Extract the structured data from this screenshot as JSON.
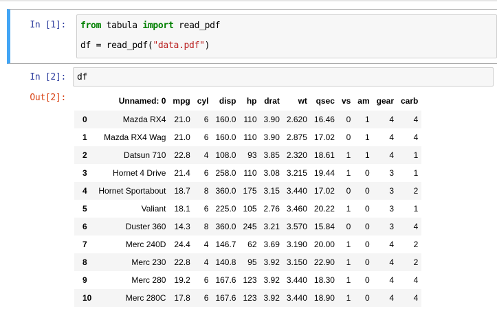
{
  "cells": [
    {
      "prompt": "In [1]:",
      "lines": [
        [
          {
            "t": "kw",
            "v": "from"
          },
          {
            "t": "plain",
            "v": " tabula "
          },
          {
            "t": "kw",
            "v": "import"
          },
          {
            "t": "plain",
            "v": " read_pdf"
          }
        ],
        [
          {
            "t": "plain",
            "v": "df = read_pdf("
          },
          {
            "t": "str",
            "v": "\"data.pdf\""
          },
          {
            "t": "plain",
            "v": ")"
          }
        ]
      ]
    },
    {
      "prompt": "In [2]:",
      "lines": [
        [
          {
            "t": "plain",
            "v": "df"
          }
        ]
      ]
    }
  ],
  "output": {
    "prompt": "Out[2]:",
    "columns": [
      "Unnamed: 0",
      "mpg",
      "cyl",
      "disp",
      "hp",
      "drat",
      "wt",
      "qsec",
      "vs",
      "am",
      "gear",
      "carb"
    ],
    "rows": [
      {
        "index": "0",
        "values": [
          "Mazda RX4",
          "21.0",
          "6",
          "160.0",
          "110",
          "3.90",
          "2.620",
          "16.46",
          "0",
          "1",
          "4",
          "4"
        ]
      },
      {
        "index": "1",
        "values": [
          "Mazda RX4 Wag",
          "21.0",
          "6",
          "160.0",
          "110",
          "3.90",
          "2.875",
          "17.02",
          "0",
          "1",
          "4",
          "4"
        ]
      },
      {
        "index": "2",
        "values": [
          "Datsun 710",
          "22.8",
          "4",
          "108.0",
          "93",
          "3.85",
          "2.320",
          "18.61",
          "1",
          "1",
          "4",
          "1"
        ]
      },
      {
        "index": "3",
        "values": [
          "Hornet 4 Drive",
          "21.4",
          "6",
          "258.0",
          "110",
          "3.08",
          "3.215",
          "19.44",
          "1",
          "0",
          "3",
          "1"
        ]
      },
      {
        "index": "4",
        "values": [
          "Hornet Sportabout",
          "18.7",
          "8",
          "360.0",
          "175",
          "3.15",
          "3.440",
          "17.02",
          "0",
          "0",
          "3",
          "2"
        ]
      },
      {
        "index": "5",
        "values": [
          "Valiant",
          "18.1",
          "6",
          "225.0",
          "105",
          "2.76",
          "3.460",
          "20.22",
          "1",
          "0",
          "3",
          "1"
        ]
      },
      {
        "index": "6",
        "values": [
          "Duster 360",
          "14.3",
          "8",
          "360.0",
          "245",
          "3.21",
          "3.570",
          "15.84",
          "0",
          "0",
          "3",
          "4"
        ]
      },
      {
        "index": "7",
        "values": [
          "Merc 240D",
          "24.4",
          "4",
          "146.7",
          "62",
          "3.69",
          "3.190",
          "20.00",
          "1",
          "0",
          "4",
          "2"
        ]
      },
      {
        "index": "8",
        "values": [
          "Merc 230",
          "22.8",
          "4",
          "140.8",
          "95",
          "3.92",
          "3.150",
          "22.90",
          "1",
          "0",
          "4",
          "2"
        ]
      },
      {
        "index": "9",
        "values": [
          "Merc 280",
          "19.2",
          "6",
          "167.6",
          "123",
          "3.92",
          "3.440",
          "18.30",
          "1",
          "0",
          "4",
          "4"
        ]
      },
      {
        "index": "10",
        "values": [
          "Merc 280C",
          "17.8",
          "6",
          "167.6",
          "123",
          "3.92",
          "3.440",
          "18.90",
          "1",
          "0",
          "4",
          "4"
        ]
      }
    ]
  }
}
